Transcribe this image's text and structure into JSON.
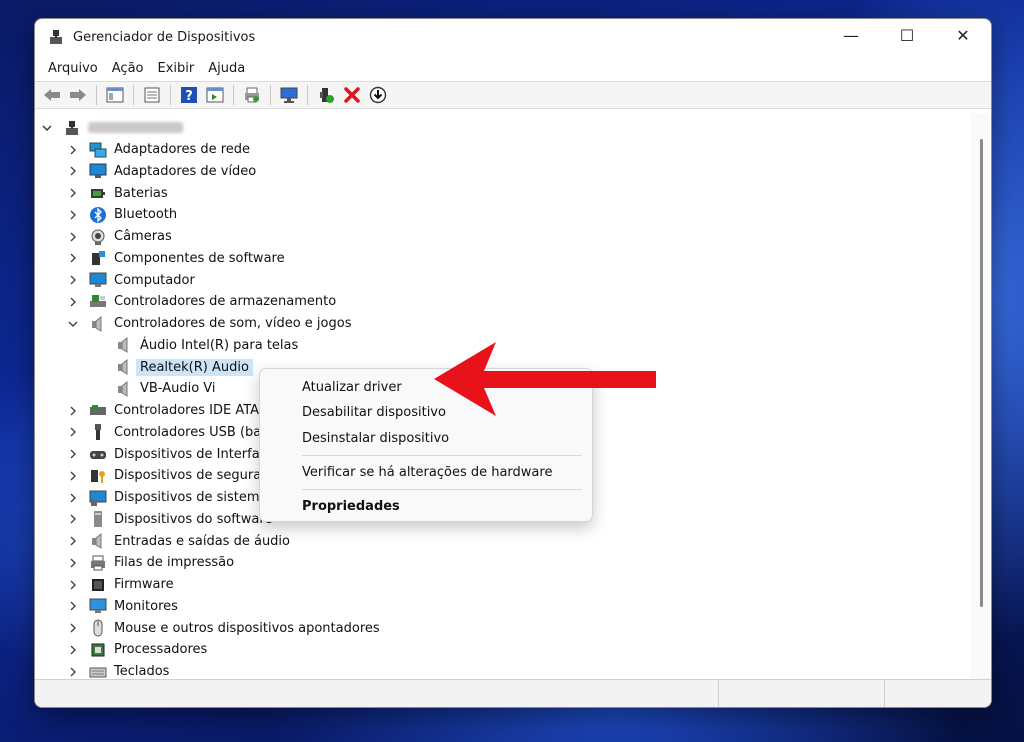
{
  "window": {
    "title": "Gerenciador de Dispositivos",
    "minimize": "—",
    "maximize": "☐",
    "close": "✕"
  },
  "menu": [
    "Arquivo",
    "Ação",
    "Exibir",
    "Ajuda"
  ],
  "toolbar_icons": [
    "back-arrow-icon",
    "forward-arrow-icon",
    "show-hide-console-tree-icon",
    "properties-icon",
    "help-icon",
    "action-pane-icon",
    "print-icon",
    "scan-hardware-icon",
    "update-driver-icon",
    "uninstall-icon",
    "download-driver-icon"
  ],
  "tree": {
    "root_label": "",
    "items": [
      {
        "label": "Adaptadores de rede",
        "icon": "network-adapter-icon",
        "expanded": false
      },
      {
        "label": "Adaptadores de vídeo",
        "icon": "display-adapter-icon",
        "expanded": false
      },
      {
        "label": "Baterias",
        "icon": "battery-icon",
        "expanded": false
      },
      {
        "label": "Bluetooth",
        "icon": "bluetooth-icon",
        "expanded": false
      },
      {
        "label": "Câmeras",
        "icon": "camera-icon",
        "expanded": false
      },
      {
        "label": "Componentes de software",
        "icon": "software-component-icon",
        "expanded": false
      },
      {
        "label": "Computador",
        "icon": "computer-icon",
        "expanded": false
      },
      {
        "label": "Controladores de armazenamento",
        "icon": "storage-controller-icon",
        "expanded": false
      },
      {
        "label": "Controladores de som, vídeo e jogos",
        "icon": "speaker-icon",
        "expanded": true
      },
      {
        "label": "Áudio Intel(R) para telas",
        "icon": "speaker-icon",
        "child": true
      },
      {
        "label": "Realtek(R) Audio",
        "icon": "speaker-icon",
        "child": true,
        "selected": true
      },
      {
        "label": "VB-Audio Vi",
        "icon": "speaker-icon",
        "child": true
      },
      {
        "label": "Controladores IDE ATA/",
        "icon": "ide-controller-icon",
        "expanded": false
      },
      {
        "label": "Controladores USB (ba",
        "icon": "usb-icon",
        "expanded": false
      },
      {
        "label": "Dispositivos de Interfac",
        "icon": "hid-icon",
        "expanded": false
      },
      {
        "label": "Dispositivos de segurar",
        "icon": "security-key-icon",
        "expanded": false
      },
      {
        "label": "Dispositivos de sistema",
        "icon": "system-device-icon",
        "expanded": false
      },
      {
        "label": "Dispositivos do software",
        "icon": "software-device-icon",
        "expanded": false
      },
      {
        "label": "Entradas e saídas de áudio",
        "icon": "speaker-icon",
        "expanded": false
      },
      {
        "label": "Filas de impressão",
        "icon": "printer-icon",
        "expanded": false
      },
      {
        "label": "Firmware",
        "icon": "firmware-icon",
        "expanded": false
      },
      {
        "label": "Monitores",
        "icon": "monitor-icon",
        "expanded": false
      },
      {
        "label": "Mouse e outros dispositivos apontadores",
        "icon": "mouse-icon",
        "expanded": false
      },
      {
        "label": "Processadores",
        "icon": "processor-icon",
        "expanded": false
      },
      {
        "label": "Teclados",
        "icon": "keyboard-icon",
        "expanded": false
      }
    ]
  },
  "context_menu": {
    "update_driver": "Atualizar driver",
    "disable_device": "Desabilitar dispositivo",
    "uninstall_device": "Desinstalar dispositivo",
    "scan_hardware": "Verificar se há alterações de hardware",
    "properties": "Propriedades"
  },
  "colors": {
    "selection": "#cce4f7",
    "annotation_arrow": "#e8121b",
    "wallpaper": "#0d2a9a"
  }
}
